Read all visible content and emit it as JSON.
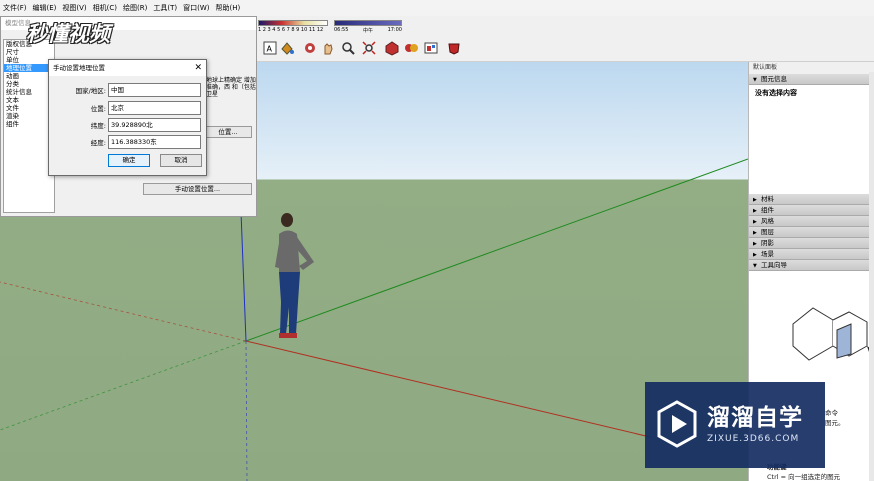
{
  "menu": [
    "文件(F)",
    "编辑(E)",
    "视图(V)",
    "相机(C)",
    "绘图(R)",
    "工具(T)",
    "窗口(W)",
    "帮助(H)"
  ],
  "toolbar": {
    "shadow_ticks": "1 2 3 4 5 6 7 8 9 10 11 12",
    "time_labels": [
      "06:55",
      "中午",
      "17:00"
    ],
    "icons": [
      "text-a-icon",
      "paint-bucket-icon",
      "pan-icon",
      "paint-icon",
      "zoom-icon",
      "zoom-extents-icon",
      "component-icon",
      "section-icon",
      "3d-warehouse-icon",
      "extension-icon"
    ]
  },
  "model_dialog": {
    "title": "模型信息",
    "items": [
      "版权信息",
      "尺寸",
      "单位",
      "地理位置",
      "动画",
      "分类",
      "统计信息",
      "文本",
      "文件",
      "渲染",
      "组件"
    ],
    "selected_index": 3,
    "desc": "地球上精确定 增加准确，西 和（包括卫星",
    "set_location_label": "位置...",
    "manual_location_label": "手动设置位置..."
  },
  "geo_dialog": {
    "title": "手动设置地理位置",
    "country_label": "国家/地区:",
    "country_value": "中国",
    "location_label": "位置:",
    "location_value": "北京",
    "latitude_label": "纬度:",
    "latitude_value": "39.928890北",
    "longitude_label": "经度:",
    "longitude_value": "116.388330东",
    "ok_label": "确定",
    "cancel_label": "取消"
  },
  "tray": {
    "title": "默认面板",
    "entity_info": "图元信息",
    "no_selection": "没有选择内容",
    "sections": [
      "材料",
      "组件",
      "风格",
      "图层",
      "阴影",
      "场景",
      "工具向导"
    ],
    "hint_line1": "命令",
    "hint_line2": "图元。",
    "hint_title": "功能键",
    "hint_line3": "Ctrl = 向一组选定的图元"
  },
  "watermark": {
    "top": "秒懂视频",
    "brand": "溜溜自学",
    "url": "ZIXUE.3D66.COM"
  },
  "colors": {
    "sky": "#e6f0f8",
    "ground": "#8fa983",
    "axis_red": "#b03020",
    "axis_green": "#1e8a1e",
    "axis_blue": "#2030c0",
    "selection": "#3399ff",
    "watermark_bg": "#142c62"
  }
}
